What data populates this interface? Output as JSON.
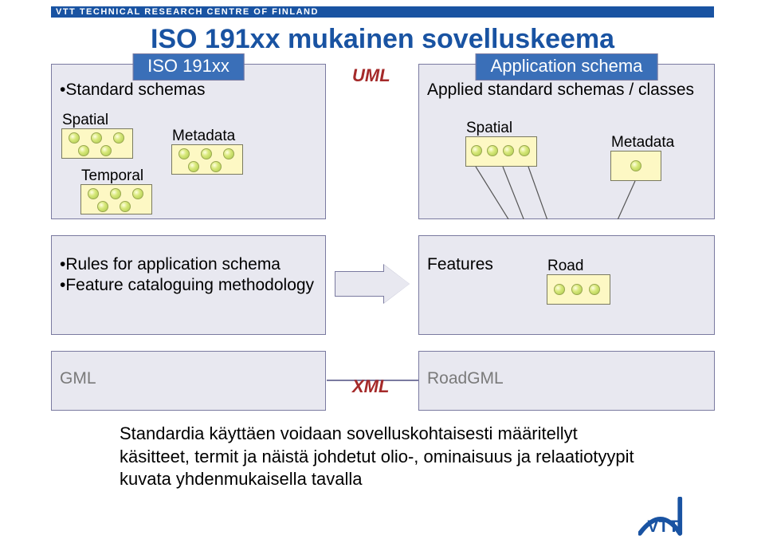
{
  "topbar": "VTT TECHNICAL RESEARCH CENTRE OF FINLAND",
  "main_title": "ISO 191xx mukainen sovelluskeema",
  "labels": {
    "uml": "UML",
    "xml": "XML"
  },
  "panels": {
    "p1l": {
      "header": "ISO 191xx",
      "bullet": "•Standard schemas",
      "boxes": {
        "spatial": "Spatial",
        "metadata": "Metadata",
        "temporal": "Temporal"
      }
    },
    "p1r": {
      "header": "Application schema",
      "bullet": "Applied standard schemas / classes",
      "boxes": {
        "spatial": "Spatial",
        "metadata": "Metadata"
      }
    },
    "p2l": {
      "bullets": [
        "•Rules for application schema",
        "•Feature cataloguing methodology"
      ]
    },
    "p2r": {
      "label": "Features",
      "box": "Road"
    },
    "p3l": {
      "label": "GML"
    },
    "p3r": {
      "label": "RoadGML"
    }
  },
  "body_text": "Standardia käyttäen voidaan sovelluskohtaisesti määritellyt käsitteet, termit ja näistä johdetut olio-, ominaisuus ja relaatiotyypit kuvata yhdenmukaisella tavalla",
  "logo": "VTT"
}
